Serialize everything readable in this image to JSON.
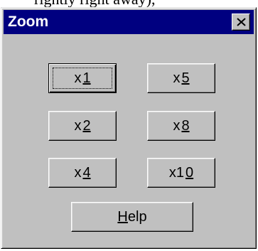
{
  "background_text": "rightly right away),",
  "dialog": {
    "title": "Zoom",
    "close_glyph": "✕"
  },
  "buttons": {
    "x1": {
      "prefix": "x",
      "mnemonic": "1",
      "rest": ""
    },
    "x5": {
      "prefix": "x",
      "mnemonic": "5",
      "rest": ""
    },
    "x2": {
      "prefix": "x",
      "mnemonic": "2",
      "rest": ""
    },
    "x8": {
      "prefix": "x",
      "mnemonic": "8",
      "rest": ""
    },
    "x4": {
      "prefix": "x",
      "mnemonic": "4",
      "rest": ""
    },
    "x10": {
      "prefix": "x1",
      "mnemonic": "0",
      "rest": ""
    },
    "help": {
      "prefix": "",
      "mnemonic": "H",
      "rest": "elp"
    }
  },
  "colors": {
    "title_bar": "#000080",
    "face": "#c0c0c0"
  }
}
